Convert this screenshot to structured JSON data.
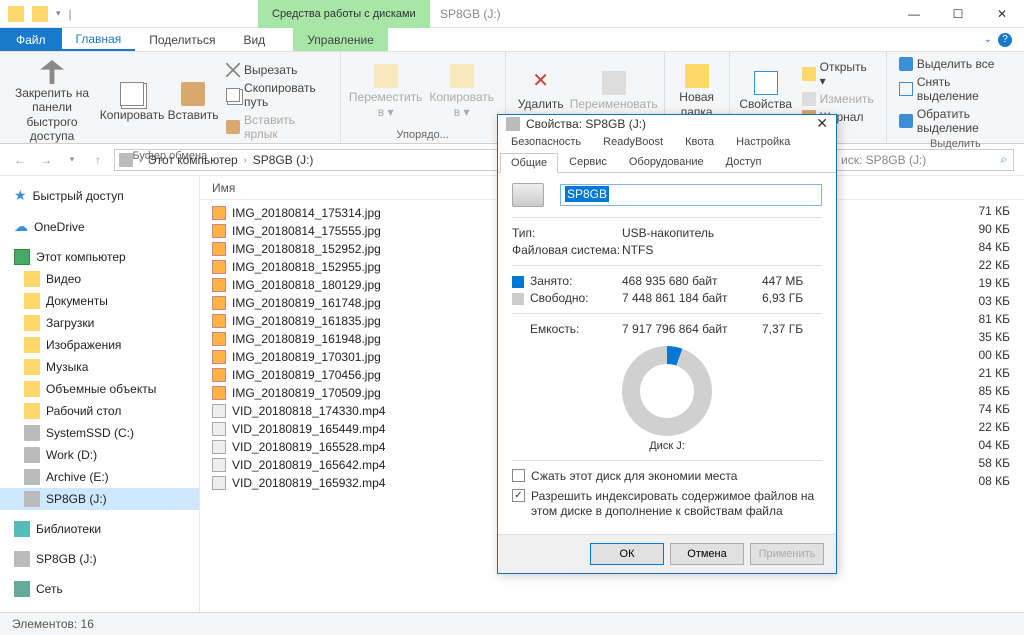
{
  "window": {
    "context_tab": "Средства работы с дисками",
    "title": "SP8GB (J:)"
  },
  "ribbon_tabs": {
    "file": "Файл",
    "home": "Главная",
    "share": "Поделиться",
    "view": "Вид",
    "manage": "Управление"
  },
  "ribbon": {
    "pin": "Закрепить на панели\nбыстрого доступа",
    "copy": "Копировать",
    "paste": "Вставить",
    "cut": "Вырезать",
    "copy_path": "Скопировать путь",
    "paste_shortcut": "Вставить ярлык",
    "clipboard": "Буфер обмена",
    "move_to": "Переместить\nв ▾",
    "copy_to": "Копировать\nв ▾",
    "organize": "Упорядо...",
    "delete": "Удалить",
    "rename": "Переименовать",
    "new_folder": "Новая\nпапка",
    "properties": "Свойства",
    "open": "Открыть ▾",
    "edit": "Изменить",
    "history": "Журнал",
    "select_all": "Выделить все",
    "select_none": "Снять выделение",
    "invert_sel": "Обратить выделение",
    "select_group": "Выделить"
  },
  "address": {
    "root": "Этот компьютер",
    "current": "SP8GB (J:)",
    "search_placeholder": "иск: SP8GB (J:)"
  },
  "nav": {
    "quick": "Быстрый доступ",
    "onedrive": "OneDrive",
    "this_pc": "Этот компьютер",
    "videos": "Видео",
    "documents": "Документы",
    "downloads": "Загрузки",
    "pictures": "Изображения",
    "music": "Музыка",
    "objects3d": "Объемные объекты",
    "desktop": "Рабочий стол",
    "systemssd": "SystemSSD (C:)",
    "work": "Work (D:)",
    "archive": "Archive (E:)",
    "sp8gb": "SP8GB (J:)",
    "libraries": "Библиотеки",
    "sp8gb2": "SP8GB (J:)",
    "network": "Сеть"
  },
  "columns": {
    "name": "Имя"
  },
  "files": [
    "IMG_20180814_175314.jpg",
    "IMG_20180814_175555.jpg",
    "IMG_20180818_152952.jpg",
    "IMG_20180818_152955.jpg",
    "IMG_20180818_180129.jpg",
    "IMG_20180819_161748.jpg",
    "IMG_20180819_161835.jpg",
    "IMG_20180819_161948.jpg",
    "IMG_20180819_170301.jpg",
    "IMG_20180819_170456.jpg",
    "IMG_20180819_170509.jpg",
    "VID_20180818_174330.mp4",
    "VID_20180819_165449.mp4",
    "VID_20180819_165528.mp4",
    "VID_20180819_165642.mp4",
    "VID_20180819_165932.mp4"
  ],
  "sizes": [
    "71 КБ",
    "90 КБ",
    "84 КБ",
    "22 КБ",
    "19 КБ",
    "03 КБ",
    "81 КБ",
    "35 КБ",
    "00 КБ",
    "21 КБ",
    "85 КБ",
    "74 КБ",
    "22 КБ",
    "04 КБ",
    "58 КБ",
    "08 КБ"
  ],
  "status": "Элементов: 16",
  "dialog": {
    "title": "Свойства: SP8GB (J:)",
    "tabs_row1": [
      "Безопасность",
      "ReadyBoost",
      "Квота",
      "Настройка"
    ],
    "tabs_row2": [
      "Общие",
      "Сервис",
      "Оборудование",
      "Доступ"
    ],
    "drive_name": "SP8GB",
    "type_k": "Тип:",
    "type_v": "USB-накопитель",
    "fs_k": "Файловая система:",
    "fs_v": "NTFS",
    "used_k": "Занято:",
    "used_bytes": "468 935 680 байт",
    "used_h": "447 МБ",
    "free_k": "Свободно:",
    "free_bytes": "7 448 861 184 байт",
    "free_h": "6,93 ГБ",
    "cap_k": "Емкость:",
    "cap_bytes": "7 917 796 864 байт",
    "cap_h": "7,37 ГБ",
    "disk_label": "Диск J:",
    "compress": "Сжать этот диск для экономии места",
    "index": "Разрешить индексировать содержимое файлов на этом диске в дополнение к свойствам файла",
    "ok": "ОК",
    "cancel": "Отмена",
    "apply": "Применить"
  },
  "chart_data": {
    "type": "pie",
    "title": "Диск J:",
    "series": [
      {
        "name": "Занято",
        "value": 468935680,
        "human": "447 МБ",
        "color": "#0078d7"
      },
      {
        "name": "Свободно",
        "value": 7448861184,
        "human": "6,93 ГБ",
        "color": "#cccccc"
      }
    ],
    "total": {
      "value": 7917796864,
      "human": "7,37 ГБ"
    }
  }
}
